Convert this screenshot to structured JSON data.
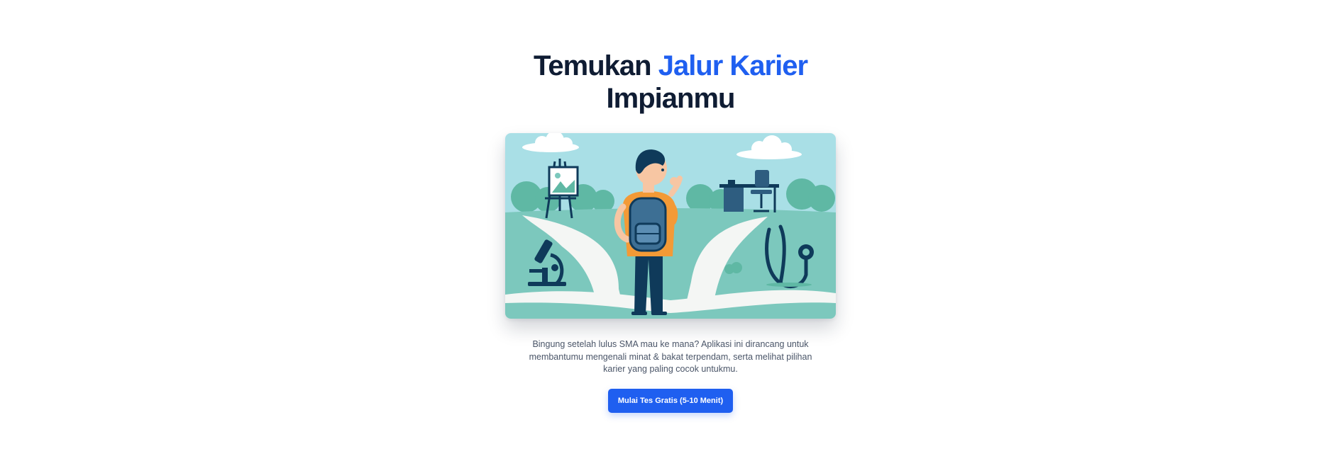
{
  "hero": {
    "title_part1": "Temukan ",
    "title_accent": "Jalur Karier",
    "title_part2": "Impianmu",
    "description": "Bingung setelah lulus SMA mau ke mana? Aplikasi ini dirancang untuk membantumu mengenali minat & bakat terpendam, serta melihat pilihan karier yang paling cocok untukmu.",
    "cta_label": "Mulai Tes Gratis (5-10 Menit)"
  },
  "illustration": {
    "subject": "student-at-crossroads",
    "icons": [
      "easel-icon",
      "microscope-icon",
      "desk-icon",
      "stethoscope-icon"
    ]
  },
  "colors": {
    "accent": "#1f5ff0",
    "heading": "#0f1c33",
    "body_text": "#4a5568",
    "sky": "#a9dfe6",
    "grass": "#7cc8bd",
    "backpack": "#3d6f94",
    "shirt": "#f39a36",
    "navy": "#0f3a5a"
  }
}
